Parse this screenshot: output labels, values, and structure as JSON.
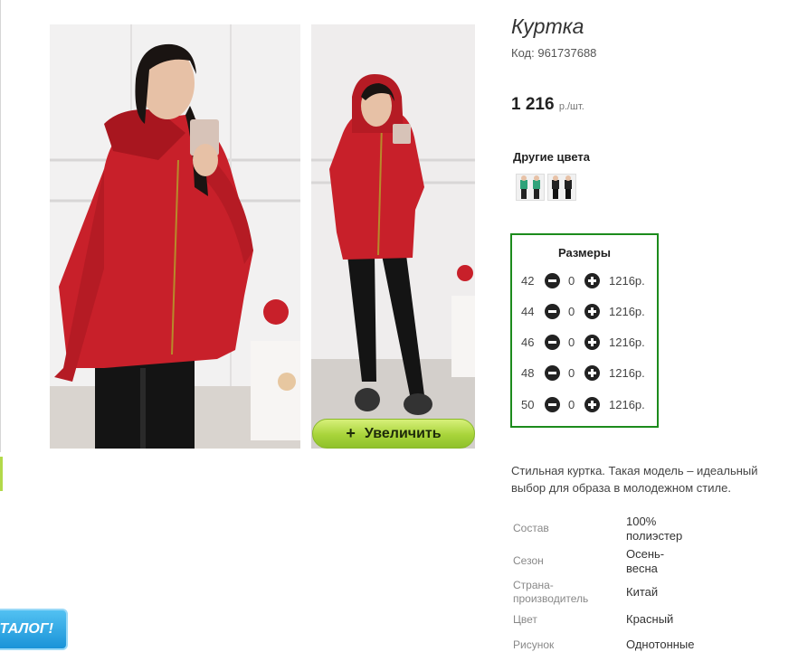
{
  "product": {
    "title": "Куртка",
    "code_label": "Код:",
    "code": "961737688",
    "price": "1 216",
    "price_unit": "р./шт."
  },
  "gallery": {
    "zoom_label": "Увеличить",
    "zoom_icon": "+"
  },
  "other_colors": {
    "title": "Другие цвета",
    "thumbs": [
      "green-outfit-thumb",
      "black-outfit-thumb"
    ]
  },
  "sizes": {
    "title": "Размеры",
    "rows": [
      {
        "size": "42",
        "qty": "0",
        "price": "1216р."
      },
      {
        "size": "44",
        "qty": "0",
        "price": "1216р."
      },
      {
        "size": "46",
        "qty": "0",
        "price": "1216р."
      },
      {
        "size": "48",
        "qty": "0",
        "price": "1216р."
      },
      {
        "size": "50",
        "qty": "0",
        "price": "1216р."
      }
    ]
  },
  "description": "Стильная куртка. Такая модель – идеальный выбор для образа в молодежном стиле.",
  "specs": [
    {
      "label": "Состав",
      "value": "100% полиэстер"
    },
    {
      "label": "Сезон",
      "value": "Осень-весна"
    },
    {
      "label": "Страна-производитель",
      "value": "Китай"
    },
    {
      "label": "Цвет",
      "value": "Красный"
    },
    {
      "label": "Рисунок",
      "value": "Однотонные"
    }
  ],
  "catalog_button": "ТАЛОГ!",
  "colors": {
    "accent_green": "#1c8b1c",
    "zoom_button": "#a8d43a",
    "catalog_blue": "#1a93d8",
    "jacket_red": "#c8202a"
  }
}
